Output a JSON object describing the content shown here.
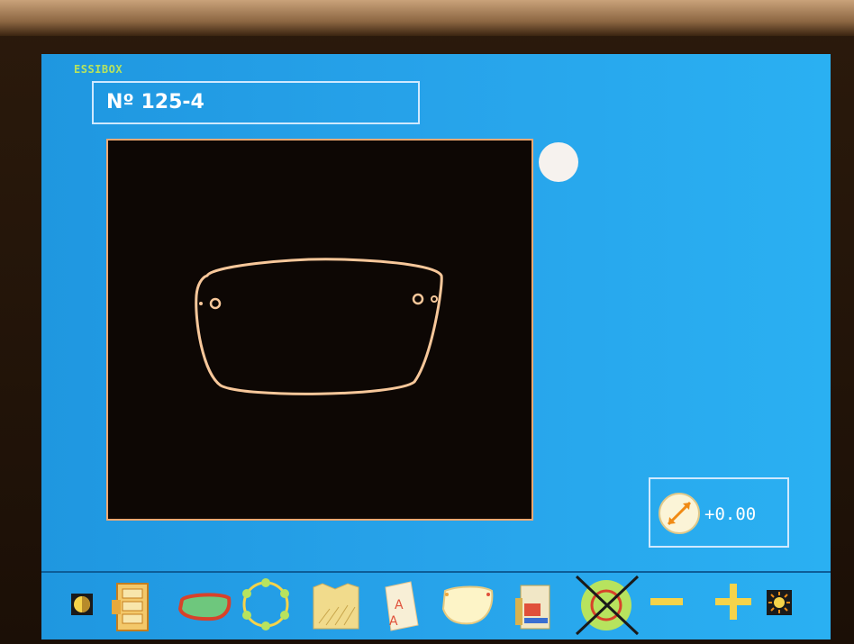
{
  "brand": "ESSIBOX",
  "job": {
    "label": "Nº 125-4"
  },
  "diameter": {
    "value": "+0.00",
    "icon": "diameter-icon"
  },
  "toolbar": {
    "icons": [
      "contrast-icon",
      "storage-icon",
      "lens-shape-icon",
      "point-circle-icon",
      "texture-icon",
      "text-engrave-icon",
      "edge-shape-icon",
      "drive-icon",
      "cancel-trace-icon",
      "decrease-icon",
      "increase-icon",
      "brightness-icon"
    ]
  },
  "colors": {
    "screen_bg": "#27a3ea",
    "trace": "#f7c79a",
    "canvas_bg": "#0d0704",
    "accent_yellow": "#f5d34a"
  }
}
